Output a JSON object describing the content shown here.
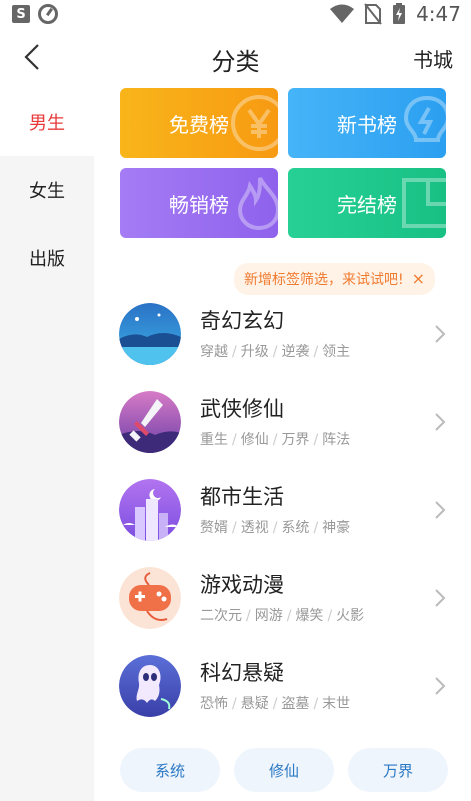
{
  "status_bar": {
    "time": "4:47"
  },
  "header": {
    "title": "分类",
    "right_link": "书城"
  },
  "left_nav": {
    "items": [
      {
        "label": "男生",
        "active": true
      },
      {
        "label": "女生",
        "active": false
      },
      {
        "label": "出版",
        "active": false
      }
    ]
  },
  "rankings": [
    {
      "label": "免费榜",
      "color": "#f9a716",
      "icon": "yen-icon"
    },
    {
      "label": "新书榜",
      "color": "#3aa9f5",
      "icon": "bulb-icon"
    },
    {
      "label": "畅销榜",
      "color": "#9a6ef0",
      "icon": "flame-icon"
    },
    {
      "label": "完结榜",
      "color": "#1fc98e",
      "icon": "book-icon"
    }
  ],
  "tip": {
    "text": "新增标签筛选，来试试吧!",
    "close": "×"
  },
  "categories": [
    {
      "title": "奇幻玄幻",
      "tags": [
        "穿越",
        "升级",
        "逆袭",
        "领主"
      ],
      "icon": "fantasy-landscape-icon"
    },
    {
      "title": "武侠修仙",
      "tags": [
        "重生",
        "修仙",
        "万界",
        "阵法"
      ],
      "icon": "sword-icon"
    },
    {
      "title": "都市生活",
      "tags": [
        "赘婿",
        "透视",
        "系统",
        "神豪"
      ],
      "icon": "city-buildings-icon"
    },
    {
      "title": "游戏动漫",
      "tags": [
        "二次元",
        "网游",
        "爆笑",
        "火影"
      ],
      "icon": "gamepad-icon"
    },
    {
      "title": "科幻悬疑",
      "tags": [
        "恐怖",
        "悬疑",
        "盗墓",
        "末世"
      ],
      "icon": "ghost-icon"
    }
  ],
  "bottom_tags": [
    "系统",
    "修仙",
    "万界"
  ]
}
